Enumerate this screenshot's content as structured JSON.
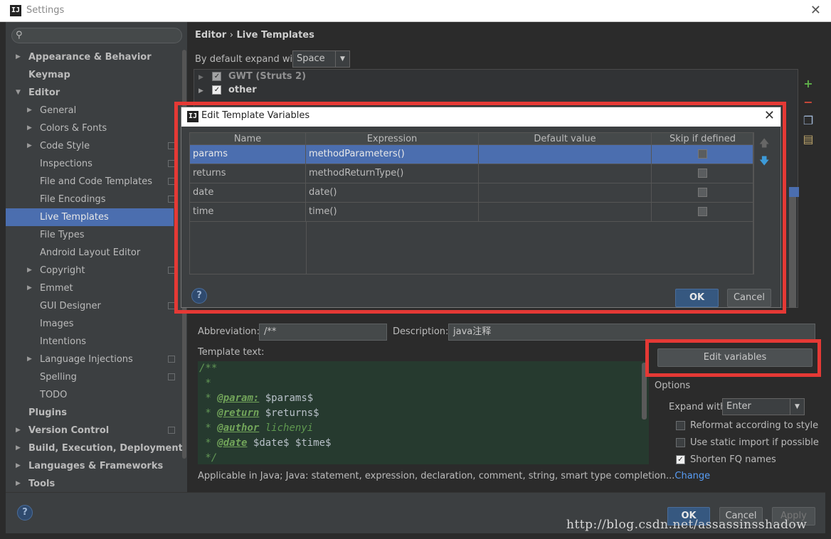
{
  "window": {
    "title": "Settings",
    "logo": "IJ"
  },
  "search": {
    "placeholder": ""
  },
  "sidebar": {
    "items": [
      {
        "label": "Appearance & Behavior",
        "bold": true,
        "arrow": "▶"
      },
      {
        "label": "Keymap",
        "bold": true,
        "arrow": ""
      },
      {
        "label": "Editor",
        "bold": true,
        "arrow": "▼"
      },
      {
        "label": "General",
        "arrow": "▶"
      },
      {
        "label": "Colors & Fonts",
        "arrow": "▶"
      },
      {
        "label": "Code Style",
        "arrow": "▶"
      },
      {
        "label": "Inspections",
        "arrow": ""
      },
      {
        "label": "File and Code Templates",
        "arrow": ""
      },
      {
        "label": "File Encodings",
        "arrow": ""
      },
      {
        "label": "Live Templates",
        "arrow": ""
      },
      {
        "label": "File Types",
        "arrow": ""
      },
      {
        "label": "Android Layout Editor",
        "arrow": ""
      },
      {
        "label": "Copyright",
        "arrow": "▶"
      },
      {
        "label": "Emmet",
        "arrow": "▶"
      },
      {
        "label": "GUI Designer",
        "arrow": ""
      },
      {
        "label": "Images",
        "arrow": ""
      },
      {
        "label": "Intentions",
        "arrow": ""
      },
      {
        "label": "Language Injections",
        "arrow": "▶"
      },
      {
        "label": "Spelling",
        "arrow": ""
      },
      {
        "label": "TODO",
        "arrow": ""
      },
      {
        "label": "Plugins",
        "bold": true,
        "arrow": ""
      },
      {
        "label": "Version Control",
        "bold": true,
        "arrow": "▶"
      },
      {
        "label": "Build, Execution, Deployment",
        "bold": true,
        "arrow": "▶"
      },
      {
        "label": "Languages & Frameworks",
        "bold": true,
        "arrow": "▶"
      },
      {
        "label": "Tools",
        "bold": true,
        "arrow": "▶"
      }
    ]
  },
  "breadcrumb": {
    "part1": "Editor",
    "sep": "›",
    "part2": "Live Templates"
  },
  "expand": {
    "label": "By default expand with",
    "value": "Space"
  },
  "template_groups": [
    {
      "name": "GWT (Struts 2)"
    },
    {
      "name": "other"
    }
  ],
  "dialog": {
    "title": "Edit Template Variables",
    "columns": [
      "Name",
      "Expression",
      "Default value",
      "Skip if defined"
    ],
    "rows": [
      {
        "name": "params",
        "expression": "methodParameters()",
        "default": ""
      },
      {
        "name": "returns",
        "expression": "methodReturnType()",
        "default": ""
      },
      {
        "name": "date",
        "expression": "date()",
        "default": ""
      },
      {
        "name": "time",
        "expression": "time()",
        "default": ""
      }
    ],
    "ok": "OK",
    "cancel": "Cancel",
    "help": "?"
  },
  "abbreviation": {
    "label": "Abbreviation:",
    "value": "/**"
  },
  "description": {
    "label": "Description:",
    "value": "java注释"
  },
  "template_text": {
    "label": "Template text:",
    "lines": [
      "/**",
      " *",
      " * @param: $params$",
      " * @return $returns$",
      " * @author lichenyi",
      " * @date $date$ $time$",
      " */"
    ]
  },
  "edit_variables": "Edit variables",
  "options": {
    "title": "Options",
    "expand_with_label": "Expand with",
    "expand_with_value": "Enter",
    "reformat": "Reformat according to style",
    "static_import": "Use static import if possible",
    "shorten": "Shorten FQ names"
  },
  "applicable": {
    "text": "Applicable in Java; Java: statement, expression, declaration, comment, string, smart type completion...",
    "link": "Change"
  },
  "footer": {
    "ok": "OK",
    "cancel": "Cancel",
    "apply": "Apply",
    "help": "?"
  },
  "watermark": "http://blog.csdn.net/assassinsshadow",
  "colors": {
    "selection": "#4b6eaf",
    "highlight": "#e53935",
    "accent": "#365880"
  }
}
